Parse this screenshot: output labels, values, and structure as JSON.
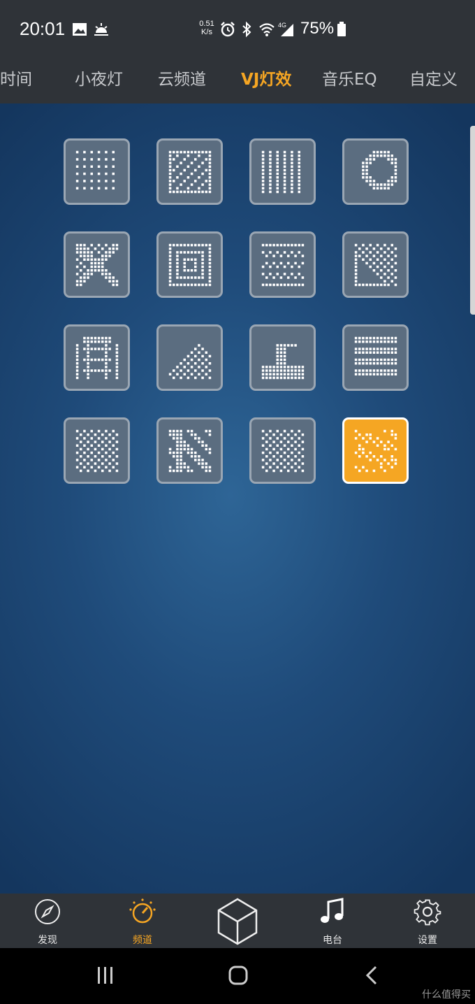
{
  "status_bar": {
    "time": "20:01",
    "net_speed_value": "0.51",
    "net_speed_unit": "K/s",
    "network": "4G",
    "battery": "75%",
    "icons": [
      "image-icon",
      "weather-icon",
      "alarm-icon",
      "bluetooth-icon",
      "wifi-icon",
      "signal-icon",
      "battery-icon"
    ]
  },
  "tabs": [
    {
      "label": "时间",
      "active": false
    },
    {
      "label": "小夜灯",
      "active": false
    },
    {
      "label": "云频道",
      "active": false
    },
    {
      "label": "VJ灯效",
      "active": true
    },
    {
      "label": "音乐EQ",
      "active": false
    },
    {
      "label": "自定义",
      "active": false
    }
  ],
  "effects": {
    "count": 16,
    "selected_index": 15,
    "icons": [
      "dot-grid-icon",
      "pixel-face-icon",
      "vertical-bars-icon",
      "curve-arc-icon",
      "pinwheel-icon",
      "concentric-square-icon",
      "pixel-wave-icon",
      "diagonal-split-icon",
      "arch-pattern-icon",
      "mountain-icon",
      "stairs-icon",
      "horizontal-lines-icon",
      "checker-diamond-icon",
      "zigzag-icon",
      "checkerboard-icon",
      "sparkle-icon"
    ]
  },
  "bottom_nav": [
    {
      "label": "发现",
      "icon": "compass-icon",
      "active": false
    },
    {
      "label": "频道",
      "icon": "knob-icon",
      "active": true
    },
    {
      "label": "",
      "icon": "cube-icon",
      "active": false
    },
    {
      "label": "电台",
      "icon": "music-note-icon",
      "active": false
    },
    {
      "label": "设置",
      "icon": "gear-icon",
      "active": false
    }
  ],
  "system_nav": {
    "icons": [
      "recents-icon",
      "home-icon",
      "back-icon"
    ]
  },
  "watermark": "什么值得买",
  "colors": {
    "accent": "#f6a623",
    "tile_bg": "#5b6d80",
    "bar_bg": "#2f3338"
  }
}
